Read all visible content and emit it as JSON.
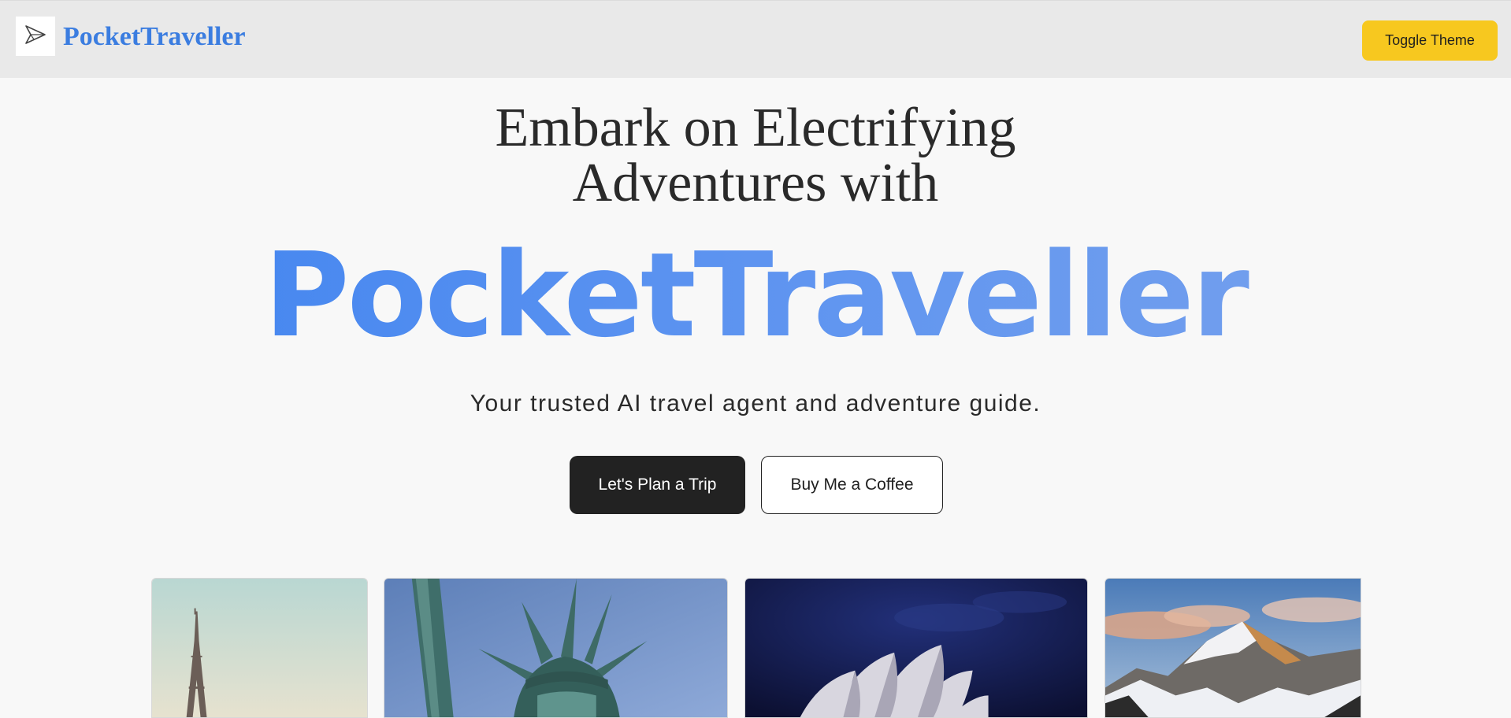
{
  "header": {
    "brand": "PocketTraveller",
    "toggle_label": "Toggle Theme",
    "logo_icon": "paper-plane-icon"
  },
  "hero": {
    "headline_line1": "Embark on Electrifying",
    "headline_line2": "Adventures with",
    "brand_big": "PocketTraveller",
    "tagline": "Your trusted AI travel agent and adventure guide.",
    "primary_button": "Let's Plan a Trip",
    "secondary_button": "Buy Me a Coffee"
  },
  "colors": {
    "brand_blue": "#3b7de0",
    "toggle_yellow": "#f7c81f",
    "primary_dark": "#222222",
    "background": "#f8f8f8",
    "header_bg": "#e9e9e9"
  },
  "gallery": {
    "cards": [
      {
        "subject": "Eiffel Tower"
      },
      {
        "subject": "Statue of Liberty"
      },
      {
        "subject": "Sydney Opera House"
      },
      {
        "subject": "Snowy mountain peak"
      }
    ]
  }
}
